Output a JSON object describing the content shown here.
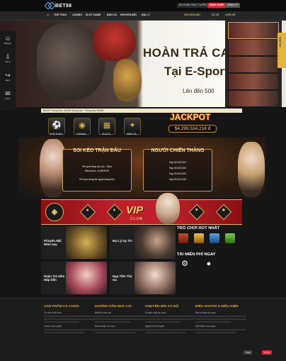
{
  "header": {
    "logo_text": "BET98",
    "btn_support": "BỐ PHẬN TRỰC TUYẾN",
    "btn_register": "ĐĂNG NHẬP",
    "btn_login": "ĐĂNG KÝ"
  },
  "nav": {
    "items": [
      "THỂ THAO",
      "CASINO",
      "SLOT GAME",
      "BẮN CÁ",
      "KHUYẾN MÃI",
      "ĐẠI LÝ"
    ],
    "right_items": [
      "KHUYẾN MÃI",
      "TẢI VỀ",
      "LIÊN HỆ"
    ]
  },
  "banner": {
    "title": "HOÀN TRẢ CAO",
    "subtitle": "Tại E-Sports",
    "note": "Lên đến 500"
  },
  "left_menu": [
    {
      "icon": "user-icon",
      "label": "Đăng ký"
    },
    {
      "icon": "download-icon",
      "label": "Tải về"
    },
    {
      "icon": "share-icon",
      "label": "Đại lý"
    },
    {
      "icon": "chat-icon",
      "label": "Hỗ trợ"
    }
  ],
  "promo_tab": "ƯU ĐÃI",
  "ticker": "Bet98 Thông báo: Bet98 thông báo: Thông báo Bet98",
  "game_icons": [
    "THỂ THAO",
    "CASINO",
    "SLOTS",
    "BẮN CÁ"
  ],
  "jackpot": {
    "title": "JACKPOT",
    "value": "$4,299,534,218 đ"
  },
  "promo_boxes": [
    {
      "title": "SOI KÈO TRẬN ĐẤU",
      "lines": [
        "Kết quả bóng đá Lịch - Bkm",
        "Barcelona, 11/05/2019",
        "Kết quả bóng đá ngoại hạng Anh"
      ]
    },
    {
      "title": "NGƯỜI CHIẾN THẮNG",
      "lines": [
        "Hạp 50,000,000",
        "Hạp 50,000,000",
        "Hạp 80,000,000",
        "Hạp 80,000,000"
      ]
    }
  ],
  "vip": {
    "title": "VIP",
    "club": "CLUB"
  },
  "tiles": [
    {
      "label": "Khuyến Mãi Hôm nay"
    },
    {
      "label": "Đại Lý Uy Tín"
    },
    {
      "label": "Hoàn Trả Siêu Hấp Dẫn"
    },
    {
      "label": "Nạp Tiền Thả Ga"
    }
  ],
  "hot_title": "TRÒ CHƠI HOT NHẤT",
  "download_title": "TẢI MIỄN PHÍ NGAY",
  "footer": {
    "columns": [
      {
        "title": "SẢN PHẨM CÁ CƯỢC",
        "items": [
          "Cá cược thể thao",
          "Casino trực tuyến"
        ]
      },
      {
        "title": "HƯỚNG DẪN NHÀ CÁI",
        "items": [
          "Bet98 là nhà cái",
          "Điều khoản cá cược"
        ]
      },
      {
        "title": "KHUYẾN MÃI CÁ ĐỘ",
        "items": [
          "Khuyến mãi cá cược",
          "Ngày tết trực tuyến"
        ]
      },
      {
        "title": "ĐIỀU KHOẢN & ĐIỀU KIỆN",
        "items": [
          "Điều khoản cá cược",
          "Giới thiệu trực tuyến"
        ]
      }
    ],
    "chat_a": "Chat",
    "chat_b": "Hỗ trợ"
  },
  "colors": {
    "accent": "#d4a94a",
    "red": "#e3263b",
    "bg": "#161616"
  }
}
